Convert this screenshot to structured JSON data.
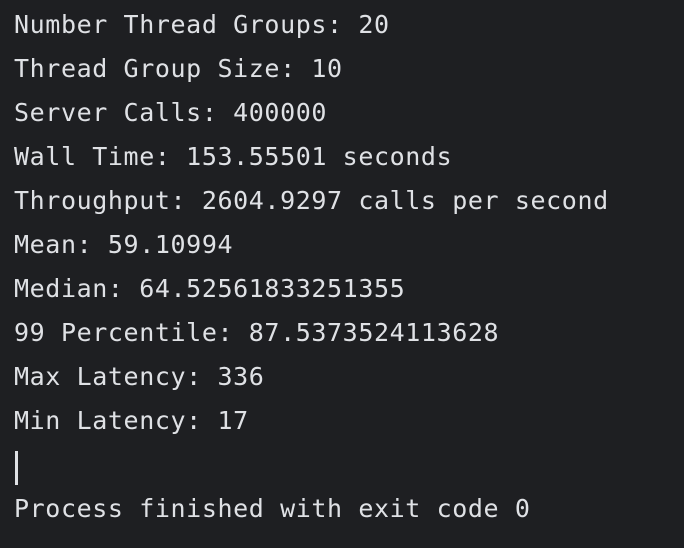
{
  "console": {
    "lines": [
      "Number Thread Groups: 20",
      "Thread Group Size: 10",
      "Server Calls: 400000",
      "Wall Time: 153.55501 seconds",
      "Throughput: 2604.9297 calls per second",
      "Mean: 59.10994",
      "Median: 64.52561833251355",
      "99 Percentile: 87.5373524113628",
      "Max Latency: 336",
      "Min Latency: 17"
    ],
    "exit_message": "Process finished with exit code 0"
  },
  "colors": {
    "background": "#1e1f22",
    "text": "#dfe1e5"
  }
}
